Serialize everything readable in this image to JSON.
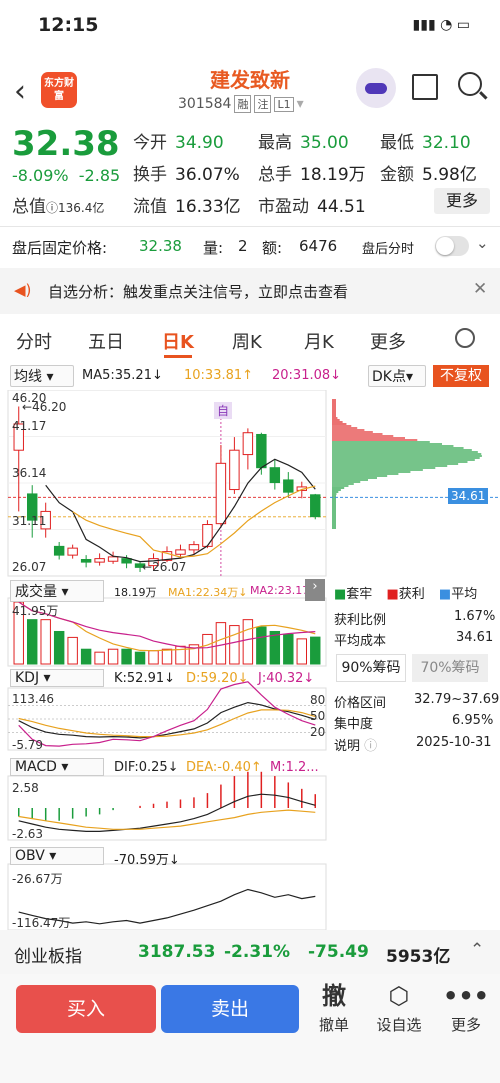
{
  "status": {
    "time": "12:15"
  },
  "header": {
    "logo_text": "东方财富",
    "name": "建发致新",
    "code": "301584",
    "tags": [
      "融",
      "注",
      "L1"
    ]
  },
  "quote": {
    "price": "32.38",
    "change_pct": "-8.09%",
    "change": "-2.85",
    "total_value_label": "总值",
    "total_value": "136.4亿",
    "fields": [
      {
        "label": "今开",
        "value": "34.90",
        "color": "g"
      },
      {
        "label": "最高",
        "value": "35.00",
        "color": "g"
      },
      {
        "label": "最低",
        "value": "32.10",
        "color": "g"
      },
      {
        "label": "换手",
        "value": "36.07%",
        "color": "k"
      },
      {
        "label": "总手",
        "value": "18.19万",
        "color": "k"
      },
      {
        "label": "金额",
        "value": "5.98亿",
        "color": "k"
      },
      {
        "label": "流值",
        "value": "16.33亿",
        "color": "k"
      },
      {
        "label": "市盈动",
        "value": "44.51",
        "color": "k"
      }
    ],
    "more": "更多"
  },
  "after_hours": {
    "label": "盘后固定价格:",
    "price": "32.38",
    "vol_label": "量:",
    "vol": "2",
    "amt_label": "额:",
    "amt": "6476",
    "time_label": "盘后分时"
  },
  "banner": {
    "text": "自选分析：触发重点关注信号，立即点击查看"
  },
  "tabs": [
    "分时",
    "五日",
    "日K",
    "周K",
    "月K",
    "更多"
  ],
  "ma": {
    "type": "均线",
    "ma5": "MA5:35.21↓",
    "ma10": "10:33.81↑",
    "ma20": "20:31.08↓",
    "dk": "DK点",
    "fq": "不复权",
    "marker": "自"
  },
  "kline": {
    "y_labels": [
      "46.20",
      "41.17",
      "36.14",
      "31.11",
      "26.07"
    ],
    "high_note": "46.20",
    "low_note": "26.07",
    "cost_line": "34.61"
  },
  "chart_data": {
    "type": "candlestick",
    "ylim": [
      26.07,
      46.2
    ],
    "candles": [
      [
        40,
        43,
        33,
        45
      ],
      [
        35,
        32,
        30,
        36
      ],
      [
        31,
        33,
        30,
        34
      ],
      [
        29,
        28,
        27.5,
        29.5
      ],
      [
        28,
        28.8,
        27.6,
        29.2
      ],
      [
        27.5,
        27.2,
        26.6,
        28
      ],
      [
        27.2,
        27.6,
        26.8,
        28.2
      ],
      [
        27.3,
        27.8,
        27,
        28.4
      ],
      [
        27.6,
        27.1,
        26.5,
        28
      ],
      [
        27,
        26.6,
        26.07,
        27.2
      ],
      [
        26.8,
        27.6,
        26.3,
        28.2
      ],
      [
        27.4,
        28.4,
        27.2,
        29
      ],
      [
        28.1,
        28.6,
        27.6,
        29.2
      ],
      [
        28.6,
        29.2,
        28,
        29.6
      ],
      [
        29,
        31.5,
        28.8,
        32
      ],
      [
        31.6,
        38.5,
        31.2,
        40.6
      ],
      [
        35.5,
        40,
        35,
        41.5
      ],
      [
        39.5,
        42,
        37.8,
        42.5
      ],
      [
        41.8,
        38,
        37.2,
        42
      ],
      [
        38,
        36.3,
        35.5,
        39
      ],
      [
        36.6,
        35.2,
        34.6,
        37.5
      ],
      [
        35.4,
        35.8,
        34.5,
        36.4
      ],
      [
        34.9,
        32.4,
        32.1,
        35
      ]
    ],
    "volume": {
      "label": "成交量",
      "vals": "18.19万",
      "ma1": "MA1:22.34万↓",
      "ma2": "MA2:23.17",
      "ymax": "41.95万",
      "bars": [
        41.95,
        30,
        30,
        22,
        18,
        10,
        8,
        10,
        10,
        8,
        9,
        10,
        12,
        13,
        20,
        28,
        26,
        30,
        25,
        22,
        20,
        17,
        18.19
      ]
    },
    "kdj": {
      "label": "KDJ",
      "k": "K:52.91↓",
      "d": "D:59.20↓",
      "j": "J:40.32↓",
      "ymax": "113.46",
      "ymin": "-5.79",
      "levels": [
        "80",
        "50",
        "20"
      ]
    },
    "macd": {
      "label": "MACD",
      "dif": "DIF:0.25↓",
      "dea": "DEA:-0.40↑",
      "m": "M:1.2...",
      "ymax": "2.58",
      "ymin": "-2.63"
    },
    "obv": {
      "label": "OBV",
      "val": "-70.59万↓",
      "ymax": "-26.67万",
      "ymin": "-116.47万"
    }
  },
  "chips": {
    "legend": [
      "套牢",
      "获利",
      "平均"
    ],
    "profit_label": "获利比例",
    "profit": "1.67%",
    "cost_label": "平均成本",
    "cost": "34.61",
    "tab1": "90%筹码",
    "tab2": "70%筹码",
    "range_label": "价格区间",
    "range": "32.79~37.69",
    "conc_label": "集中度",
    "conc": "6.95%",
    "note_label": "说明",
    "date": "2025-10-31"
  },
  "index": {
    "name": "创业板指",
    "value": "3187.53",
    "pct": "-2.31%",
    "chg": "-75.49",
    "amt": "5953亿"
  },
  "bottom": {
    "buy": "买入",
    "sell": "卖出",
    "cancel": "撤单",
    "alert": "设自选",
    "more": "更多",
    "cancel_icon": "撤"
  }
}
